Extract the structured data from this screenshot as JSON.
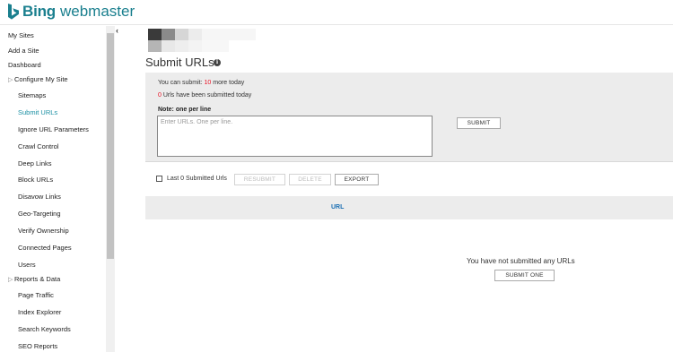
{
  "header": {
    "brand": "Bing",
    "product": "webmaster"
  },
  "sidebar": {
    "collapse_glyph": "‹",
    "items": [
      {
        "label": "My Sites"
      },
      {
        "label": "Add a Site"
      },
      {
        "label": "Dashboard"
      },
      {
        "label": "Configure My Site"
      },
      {
        "label": "Sitemaps"
      },
      {
        "label": "Submit URLs"
      },
      {
        "label": "Ignore URL Parameters"
      },
      {
        "label": "Crawl Control"
      },
      {
        "label": "Deep Links"
      },
      {
        "label": "Block URLs"
      },
      {
        "label": "Disavow Links"
      },
      {
        "label": "Geo-Targeting"
      },
      {
        "label": "Verify Ownership"
      },
      {
        "label": "Connected Pages"
      },
      {
        "label": "Users"
      },
      {
        "label": "Reports & Data"
      },
      {
        "label": "Page Traffic"
      },
      {
        "label": "Index Explorer"
      },
      {
        "label": "Search Keywords"
      },
      {
        "label": "SEO Reports"
      }
    ]
  },
  "main": {
    "title": "Submit URLs",
    "info_glyph": "i",
    "quota": {
      "prefix": "You can submit: ",
      "count": "10",
      "suffix": " more today"
    },
    "submitted": {
      "count": "0",
      "suffix": " Urls have been submitted today"
    },
    "note": "Note: one per line",
    "textarea_placeholder": "Enter URLs. One per line.",
    "submit_label": "SUBMIT",
    "last_label": "Last 0 Submitted Urls",
    "resubmit_label": "RESUBMIT",
    "delete_label": "DELETE",
    "export_label": "EXPORT",
    "table": {
      "column": "URL"
    },
    "empty_message": "You have not submitted any URLs",
    "submit_one_label": "SUBMIT ONE"
  },
  "colors": {
    "brand": "#1a7f8e",
    "active_nav": "#1a8fa3",
    "count_red": "#e81123",
    "link_blue": "#1a6fb3"
  },
  "icons": [
    "bing-logo-icon",
    "chevron-right-icon",
    "collapse-chevron-icon",
    "info-icon",
    "checkbox-icon"
  ]
}
